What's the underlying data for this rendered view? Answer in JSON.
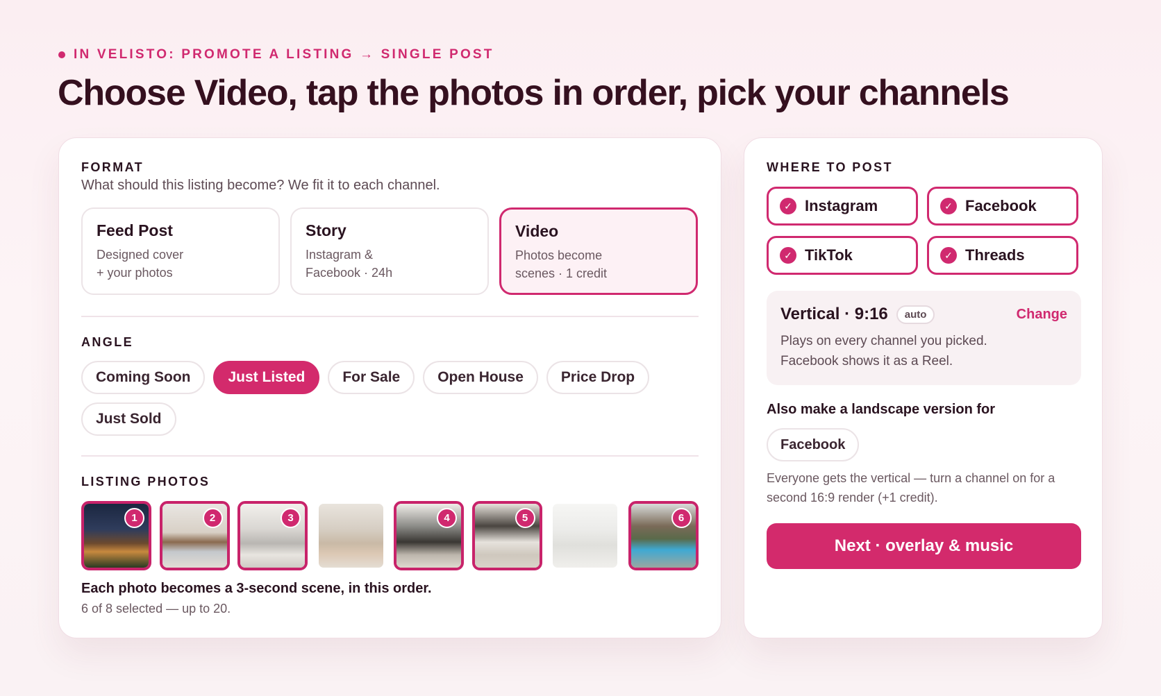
{
  "eyebrow": "IN VELISTO: PROMOTE A LISTING → SINGLE POST",
  "headline": "Choose Video, tap the photos in order, pick your channels",
  "format": {
    "title": "FORMAT",
    "subtitle": "What should this listing become? We fit it to each channel.",
    "options": [
      {
        "title": "Feed Post",
        "desc": "Designed cover\n+ your photos",
        "selected": false
      },
      {
        "title": "Story",
        "desc": "Instagram &\nFacebook · 24h",
        "selected": false
      },
      {
        "title": "Video",
        "desc": "Photos become\nscenes · 1 credit",
        "selected": true
      }
    ]
  },
  "angle": {
    "title": "ANGLE",
    "options": [
      "Coming Soon",
      "Just Listed",
      "For Sale",
      "Open House",
      "Price Drop",
      "Just Sold"
    ],
    "selected": "Just Listed"
  },
  "photos": {
    "title": "LISTING PHOTOS",
    "items": [
      {
        "order": "1",
        "selected": true
      },
      {
        "order": "2",
        "selected": true
      },
      {
        "order": "3",
        "selected": true
      },
      {
        "order": "",
        "selected": false
      },
      {
        "order": "4",
        "selected": true
      },
      {
        "order": "5",
        "selected": true
      },
      {
        "order": "",
        "selected": false
      },
      {
        "order": "6",
        "selected": true
      }
    ],
    "note": "Each photo becomes a 3-second scene, in this order.",
    "count": "6 of 8 selected — up to 20."
  },
  "where": {
    "title": "WHERE TO POST",
    "channels": [
      {
        "label": "Instagram",
        "checked": true
      },
      {
        "label": "Facebook",
        "checked": true
      },
      {
        "label": "TikTok",
        "checked": true
      },
      {
        "label": "Threads",
        "checked": true
      }
    ],
    "ratio": "Vertical · 9:16",
    "auto": "auto",
    "change": "Change",
    "ratio_desc": "Plays on every channel you picked.\nFacebook shows it as a Reel.",
    "also": "Also make a landscape version for",
    "landscape_option": "Facebook",
    "help": "Everyone gets the vertical — turn a channel on for a second 16:9 render (+1 credit).",
    "next": "Next · overlay & music"
  },
  "colors": {
    "accent": "#d0296f",
    "heading": "#35101f"
  }
}
